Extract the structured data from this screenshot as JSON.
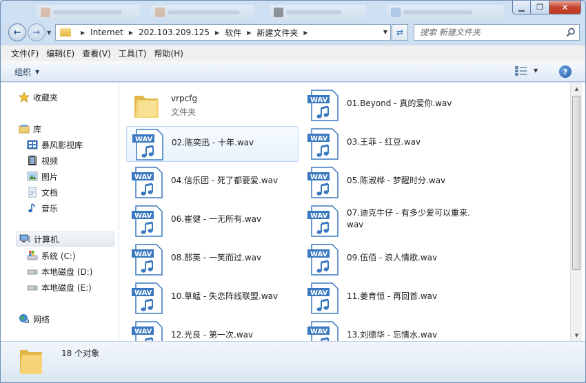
{
  "window": {
    "controls": {
      "minimize": "▁",
      "maximize": "❐",
      "close": "✕"
    }
  },
  "address": {
    "breadcrumbs": [
      "Internet",
      "202.103.209.125",
      "软件",
      "新建文件夹"
    ],
    "search_placeholder": "搜索 新建文件夹"
  },
  "menu": {
    "items": [
      "文件(F)",
      "编辑(E)",
      "查看(V)",
      "工具(T)",
      "帮助(H)"
    ]
  },
  "toolbar": {
    "organize_label": "组织",
    "help_label": "?"
  },
  "nav": {
    "favorites": "收藏夹",
    "libraries": "库",
    "library_items": [
      "暴风影视库",
      "视频",
      "图片",
      "文档",
      "音乐"
    ],
    "computer": "计算机",
    "drives": [
      "系统 (C:)",
      "本地磁盘 (D:)",
      "本地磁盘 (E:)"
    ],
    "network": "网络"
  },
  "files": {
    "folder": {
      "name": "vrpcfg",
      "type": "文件夹"
    },
    "wav_badge": "WAV",
    "items": [
      "01.Beyond - 真的爱你.wav",
      "02.陈奕迅 - 十年.wav",
      "03.王菲 - 红豆.wav",
      "04.信乐团 - 死了都要爱.wav",
      "05.陈淑桦 - 梦醒时分.wav",
      "06.崔健 - 一无所有.wav",
      "07.迪克牛仔 - 有多少爱可以重来.",
      "wav",
      "08.那英 - 一笑而过.wav",
      "09.伍佰 - 浪人情歌.wav",
      "10.草蜢 - 失恋阵线联盟.wav",
      "11.姜育恒 - 再回首.wav",
      "12.光良 - 第一次.wav",
      "13.刘德华 - 忘情水.wav"
    ]
  },
  "details": {
    "count_text": "18 个对象"
  },
  "colors": {
    "selection_border": "#b8d6fb",
    "selection_fill": "#e8f3fd",
    "wav_badge": "#3a78c0"
  }
}
